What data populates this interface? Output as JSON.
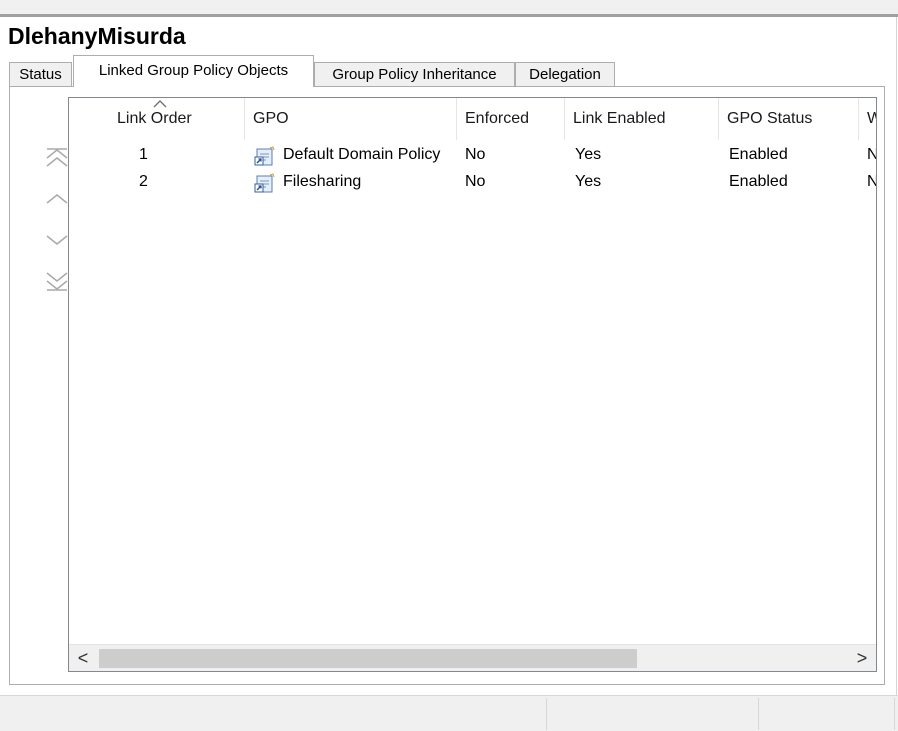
{
  "window": {
    "title": "DlehanyMisurda"
  },
  "tabs": [
    {
      "label": "Status",
      "active": false
    },
    {
      "label": "Linked Group Policy Objects",
      "active": true
    },
    {
      "label": "Group Policy Inheritance",
      "active": false
    },
    {
      "label": "Delegation",
      "active": false
    }
  ],
  "order_buttons": [
    {
      "icon": "move-to-top-icon"
    },
    {
      "icon": "move-up-icon"
    },
    {
      "icon": "move-down-icon"
    },
    {
      "icon": "move-to-bottom-icon"
    }
  ],
  "table": {
    "sorted_column": "Link Order",
    "columns": [
      "Link Order",
      "GPO",
      "Enforced",
      "Link Enabled",
      "GPO Status",
      "WMI Filter"
    ],
    "rows": [
      {
        "link_order": "1",
        "gpo": "Default Domain Policy",
        "enforced": "No",
        "link_enabled": "Yes",
        "gpo_status": "Enabled",
        "wmi_filter": "None"
      },
      {
        "link_order": "2",
        "gpo": "Filesharing",
        "enforced": "No",
        "link_enabled": "Yes",
        "gpo_status": "Enabled",
        "wmi_filter": "None"
      }
    ]
  },
  "scrollbar": {
    "left_arrow": "<",
    "right_arrow": ">",
    "thumb_fraction": 0.72
  },
  "colors": {
    "border": "#adadad",
    "list_border": "#828790",
    "chrome": "#f0f0f0",
    "button_gray": "#a9a9a9"
  }
}
